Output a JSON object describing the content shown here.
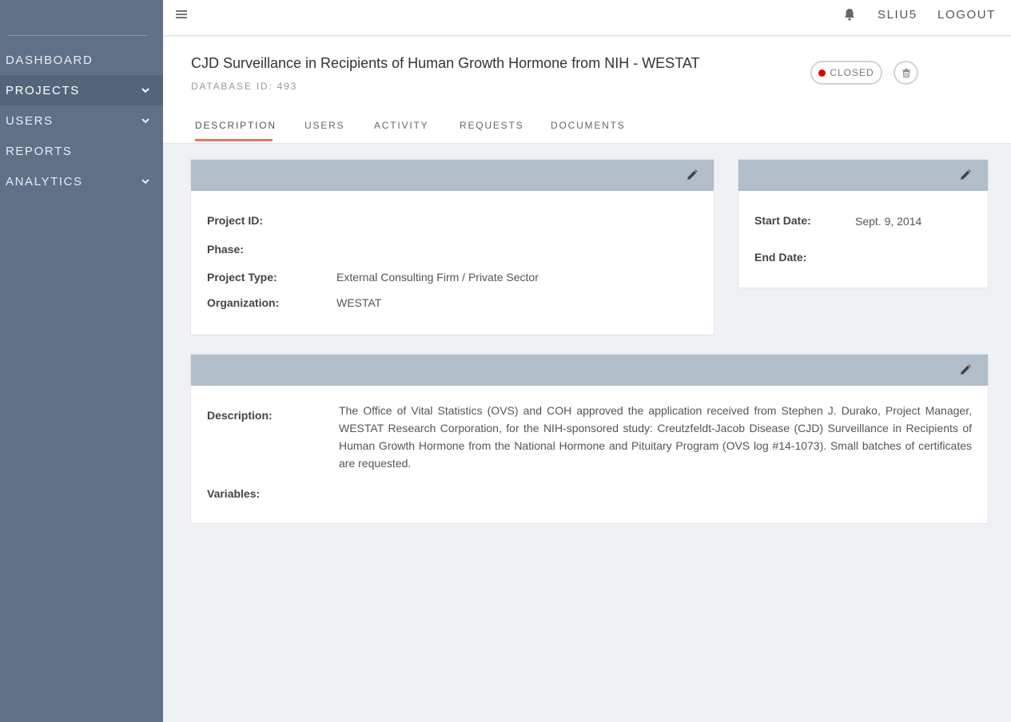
{
  "sidebar": {
    "items": [
      {
        "label": "DASHBOARD"
      },
      {
        "label": "PROJECTS"
      },
      {
        "label": "USERS"
      },
      {
        "label": "REPORTS"
      },
      {
        "label": "ANALYTICS"
      }
    ]
  },
  "topbar": {
    "username": "SLIU5",
    "logout_label": "LOGOUT"
  },
  "header": {
    "title": "CJD Surveillance in Recipients of Human Growth Hormone from NIH - WESTAT",
    "database_id": "DATABASE ID: 493",
    "status": "CLOSED"
  },
  "tabs": [
    {
      "label": "DESCRIPTION"
    },
    {
      "label": "USERS"
    },
    {
      "label": "ACTIVITY"
    },
    {
      "label": "REQUESTS"
    },
    {
      "label": "DOCUMENTS"
    }
  ],
  "details_card": {
    "project_id_label": "Project ID:",
    "project_id_value": "",
    "phase_label": "Phase:",
    "phase_value": "",
    "project_type_label": "Project Type:",
    "project_type_value": "External Consulting Firm / Private Sector",
    "organization_label": "Organization:",
    "organization_value": "WESTAT"
  },
  "dates_card": {
    "start_date_label": "Start Date:",
    "start_date_value": "Sept. 9, 2014",
    "end_date_label": "End Date:",
    "end_date_value": ""
  },
  "description_card": {
    "description_label": "Description:",
    "description_value": "The Office of Vital Statistics (OVS) and COH approved the application received from Stephen J. Durako, Project Manager, WESTAT Research Corporation, for the NIH-sponsored study: Creutzfeldt-Jacob Disease (CJD) Surveillance in Recipients of Human Growth Hormone from the National Hormone and Pituitary Program (OVS log #14-1073). Small batches of certificates are requested.",
    "variables_label": "Variables:",
    "variables_value": ""
  },
  "colors": {
    "sidebar": "#5e7187",
    "sidebar_active": "#53657a",
    "card_header": "#b1bdc8",
    "tab_accent": "#e57563",
    "status_closed": "#e10000",
    "background": "#f0f1f5"
  },
  "icons": {
    "menu": "hamburger-icon",
    "notifications": "bell-icon",
    "expand": "chevron-down-icon",
    "edit": "pencil-icon",
    "delete": "trash-icon",
    "status": "status-dot-icon"
  }
}
